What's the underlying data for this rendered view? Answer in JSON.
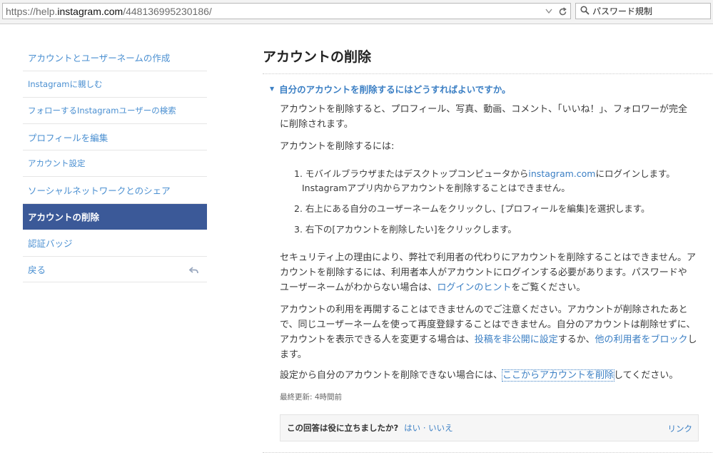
{
  "browser": {
    "url_prefix": "https://help.",
    "url_domain": "instagram.com",
    "url_path": "/448136995230186/",
    "search_value": "パスワード規制",
    "icons": [
      "dropdown-icon",
      "reload-icon",
      "search-icon"
    ]
  },
  "sidebar": {
    "items": [
      {
        "label": "アカウントとユーザーネームの作成"
      },
      {
        "label": "Instagramに親しむ"
      },
      {
        "label": "フォローするInstagramユーザーの検索"
      },
      {
        "label": "プロフィールを編集"
      },
      {
        "label": "アカウント設定"
      },
      {
        "label": "ソーシャルネットワークとのシェア"
      },
      {
        "label": "アカウントの削除"
      },
      {
        "label": "認証バッジ"
      },
      {
        "label": "戻る"
      }
    ],
    "active_index": 6,
    "active_color": "#3b5998"
  },
  "main": {
    "title": "アカウントの削除",
    "question": "自分のアカウントを削除するにはどうすればよいですか。",
    "intro_line1": "アカウントを削除すると、プロフィール、写真、動画、コメント、「いいね！」、フォロワーが完全",
    "intro_line2": "に削除されます。",
    "howto": "アカウントを削除するには:",
    "steps": {
      "s1_a": "1. モバイルブラウザまたはデスクトップコンピュータから",
      "s1_link": "instagram.com",
      "s1_b": "にログインします。",
      "s1_line2": "Instagramアプリ内からアカウントを削除することはできません。",
      "s2": "2. 右上にある自分のユーザーネームをクリックし、[プロフィールを編集]を選択します。",
      "s3": "3. 右下の[アカウントを削除したい]をクリックします。"
    },
    "security": {
      "line1": "セキュリティ上の理由により、弊社で利用者の代わりにアカウントを削除することはできません。ア",
      "line2": "カウントを削除するには、利用者本人がアカウントにログインする必要があります。パスワードや",
      "line3_a": "ユーザーネームがわからない場合は、",
      "line3_link": "ログインのヒント",
      "line3_b": "をご覧ください。"
    },
    "reactivate": {
      "line1": "アカウントの利用を再開することはできませんのでご注意ください。アカウントが削除されたあと",
      "line2": "で、同じユーザーネームを使って再度登録することはできません。自分のアカウントは削除せずに、",
      "line3_a": "アカウントを表示できる人を変更する場合は、",
      "line3_link1": "投稿を非公開に設定",
      "line3_b": "するか、",
      "line3_link2": "他の利用者をブロック",
      "line3_c": "し",
      "line4": "ます。"
    },
    "settings": {
      "a": "設定から自分のアカウントを削除できない場合には、",
      "link": "ここからアカウントを削除",
      "b": "してください。"
    },
    "updated": "最終更新: 4時間前",
    "feedback": {
      "question": "この回答は役に立ちましたか?",
      "yes_no": "はい · いいえ",
      "link": "リンク"
    },
    "link_color": "#3b7fc4"
  }
}
